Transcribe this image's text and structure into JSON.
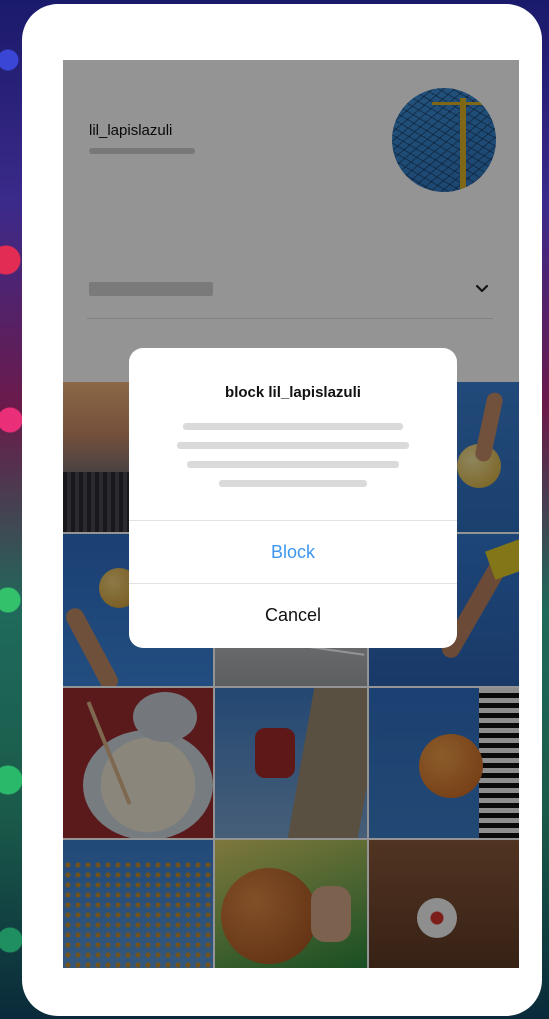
{
  "profile": {
    "username": "lil_lapislazuli",
    "avatar_icon": "volleyball-net-photo",
    "dropdown_icon": "chevron-down-icon"
  },
  "photo_grid": {
    "tiles": [
      {
        "subject": "city-skyline-sunset"
      },
      {
        "subject": "blurred-placeholder"
      },
      {
        "subject": "holding-volleyball"
      },
      {
        "subject": "volleyball-in-air"
      },
      {
        "subject": "volleyball-court"
      },
      {
        "subject": "arm-reaching"
      },
      {
        "subject": "dumplings-with-chopsticks"
      },
      {
        "subject": "climber-on-rock"
      },
      {
        "subject": "holding-basketball"
      },
      {
        "subject": "tree-with-berries"
      },
      {
        "subject": "basketball-in-hands"
      },
      {
        "subject": "soccer-ball-on-rock"
      }
    ]
  },
  "dialog": {
    "title": "block lil_lapislazuli",
    "block_label": "Block",
    "cancel_label": "Cancel",
    "block_color": "#3d97f0"
  }
}
